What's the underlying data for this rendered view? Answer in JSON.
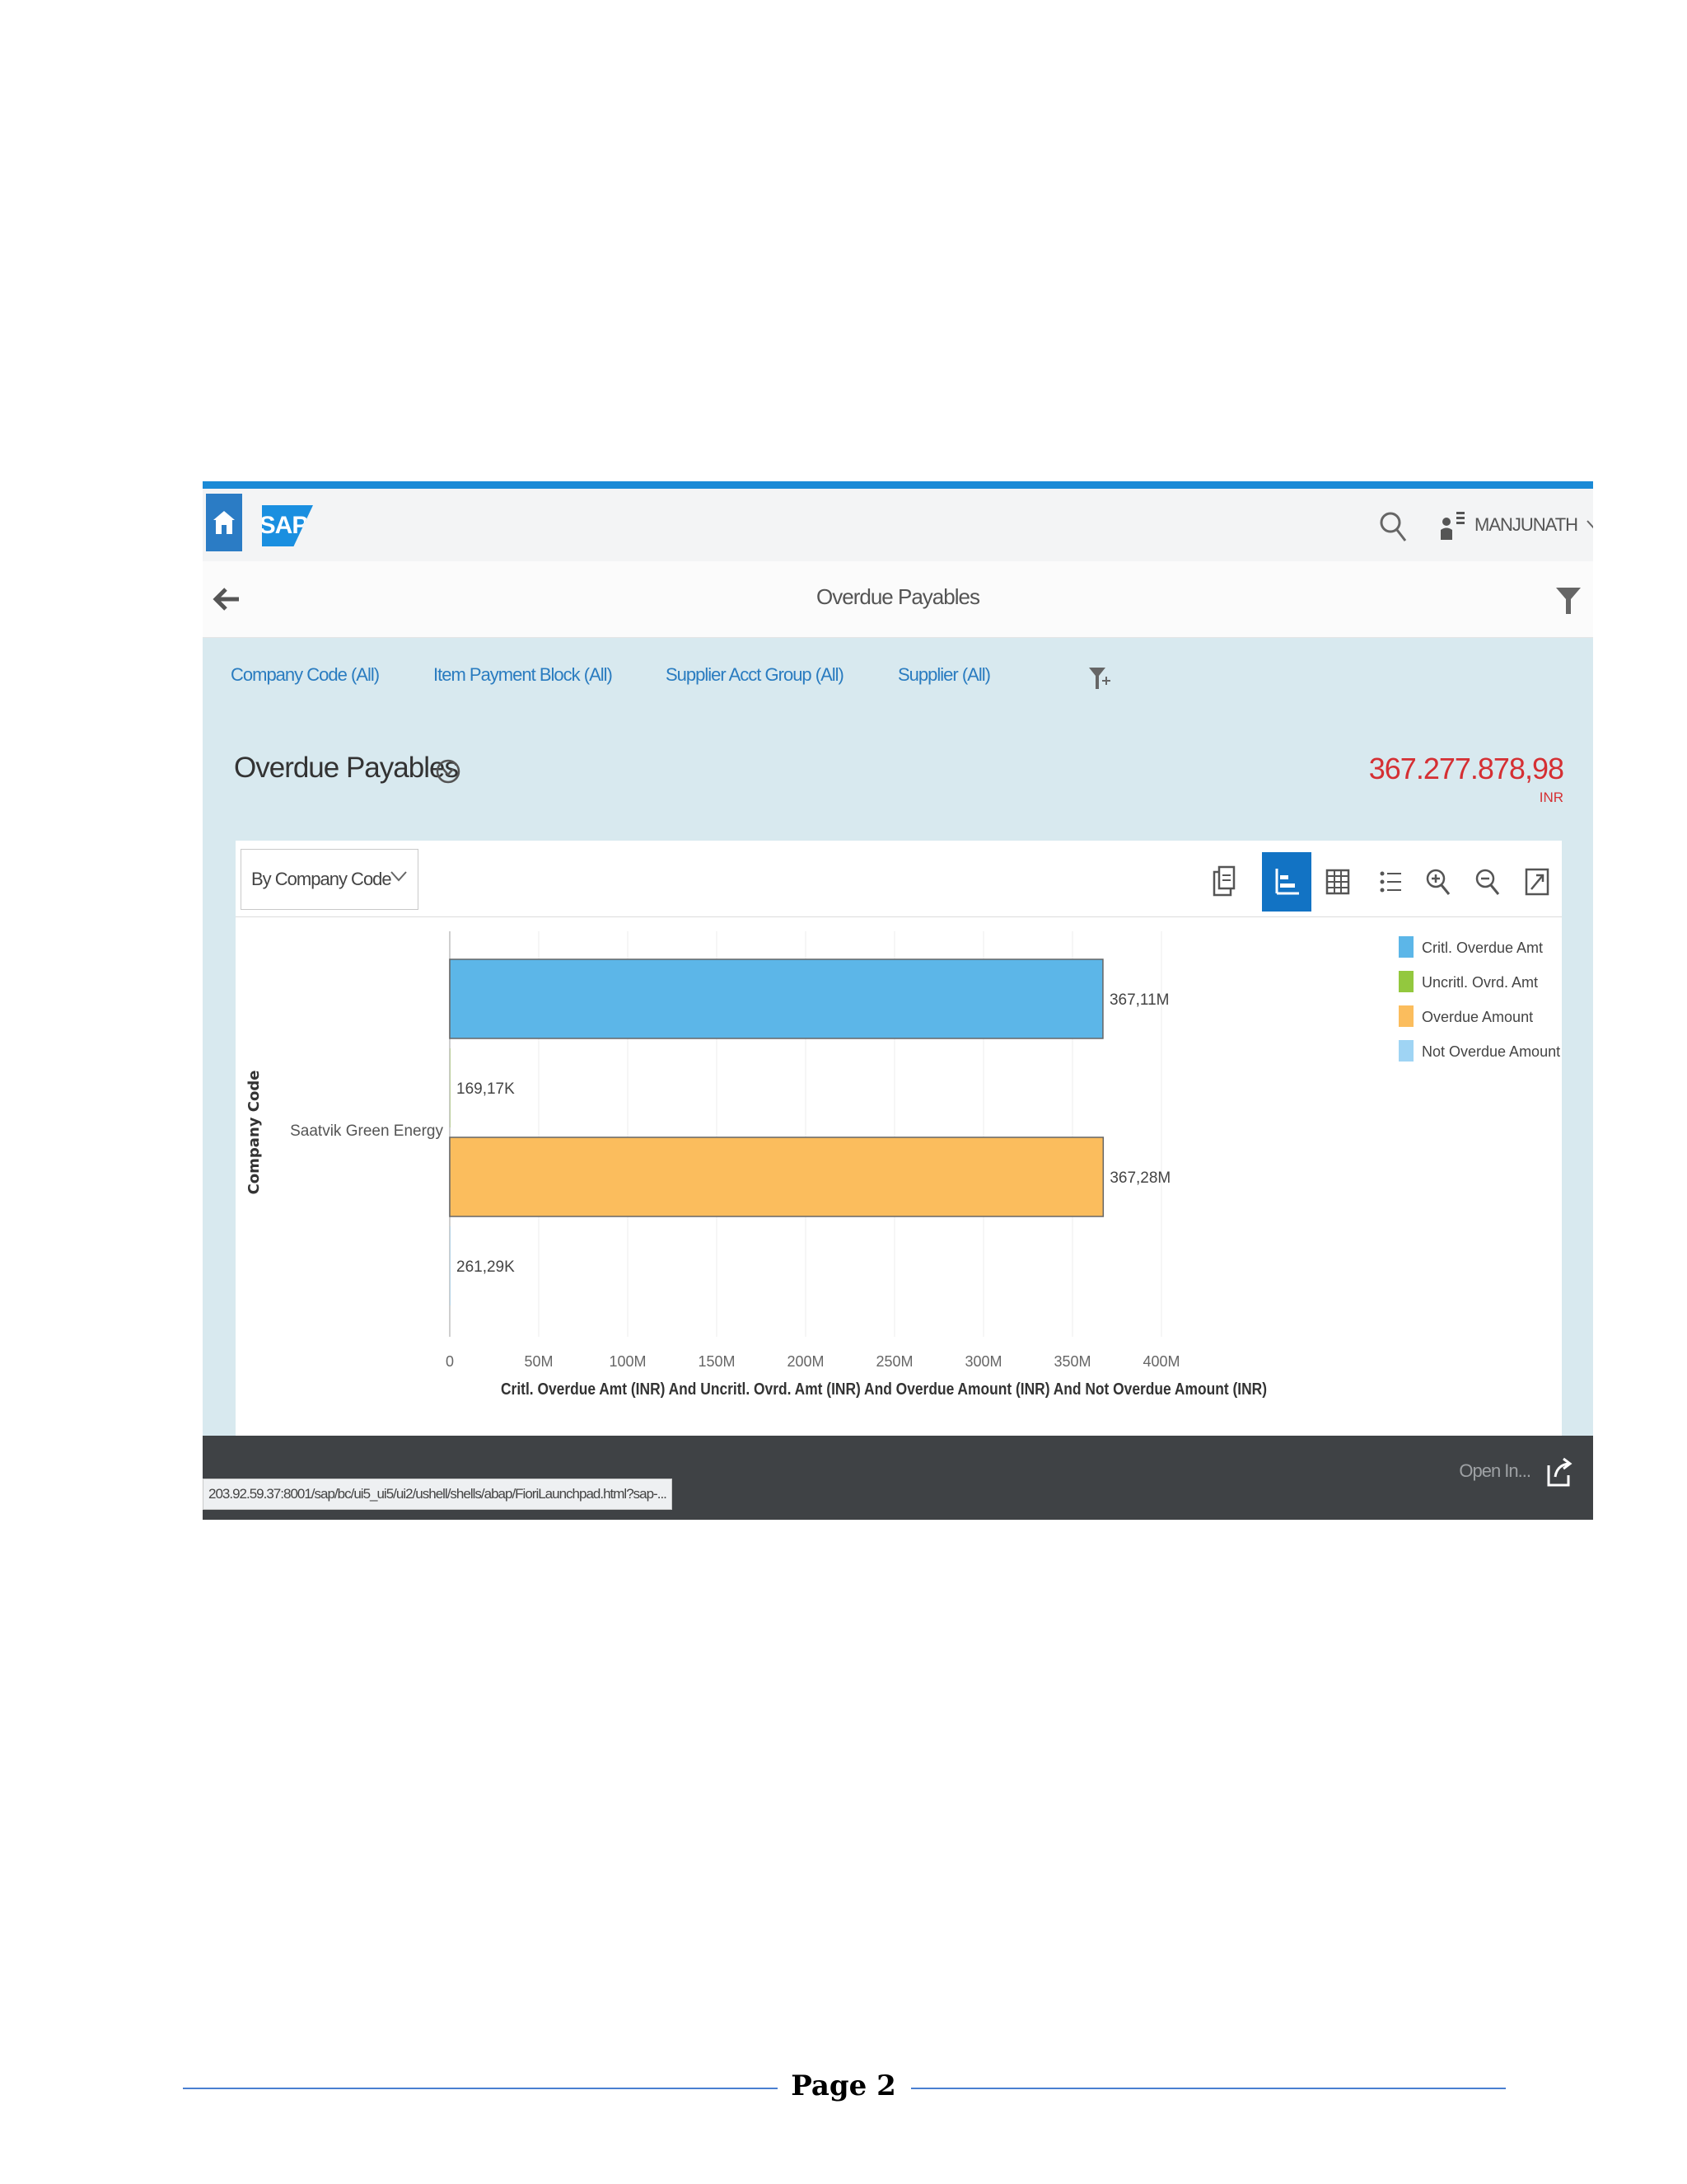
{
  "shell": {
    "brand": "SAP",
    "user_name": "MANJUNATH"
  },
  "header": {
    "title": "Overdue Payables"
  },
  "filters": [
    {
      "label": "Company Code (All)"
    },
    {
      "label": "Item Payment Block (All)"
    },
    {
      "label": "Supplier Acct Group (All)"
    },
    {
      "label": "Supplier (All)"
    }
  ],
  "kpi": {
    "title": "Overdue Payables",
    "value": "367.277.878,98",
    "unit": "INR"
  },
  "card": {
    "view_select": "By Company Code"
  },
  "chart_data": {
    "type": "bar",
    "orientation": "horizontal",
    "ylabel": "Company Code",
    "xlabel": "Critl. Overdue Amt (INR) And Uncritl. Ovrd. Amt (INR) And Overdue Amount (INR) And Not Overdue Amount (INR)",
    "categories": [
      "Saatvik Green Energy"
    ],
    "xlim": [
      0,
      400000000
    ],
    "x_ticks": [
      "0",
      "50M",
      "100M",
      "150M",
      "200M",
      "250M",
      "300M",
      "350M",
      "400M"
    ],
    "grid": true,
    "legend_position": "right",
    "series": [
      {
        "name": "Critl. Overdue Amt",
        "values": [
          367110000
        ],
        "label": "367,11M",
        "color": "#5cb6e8"
      },
      {
        "name": "Uncritl. Ovrd. Amt",
        "values": [
          169170
        ],
        "label": "169,17K",
        "color": "#93c83e"
      },
      {
        "name": "Overdue Amount",
        "values": [
          367280000
        ],
        "label": "367,28M",
        "color": "#fbbd5d"
      },
      {
        "name": "Not Overdue Amount",
        "values": [
          261290
        ],
        "label": "261,29K",
        "color": "#9fd4f4"
      }
    ]
  },
  "footer": {
    "open_in": "Open In...",
    "status_url": "203.92.59.37:8001/sap/bc/ui5_ui5/ui2/ushell/shells/abap/FioriLaunchpad.html?sap-..."
  },
  "page": {
    "number_label": "Page 2"
  }
}
